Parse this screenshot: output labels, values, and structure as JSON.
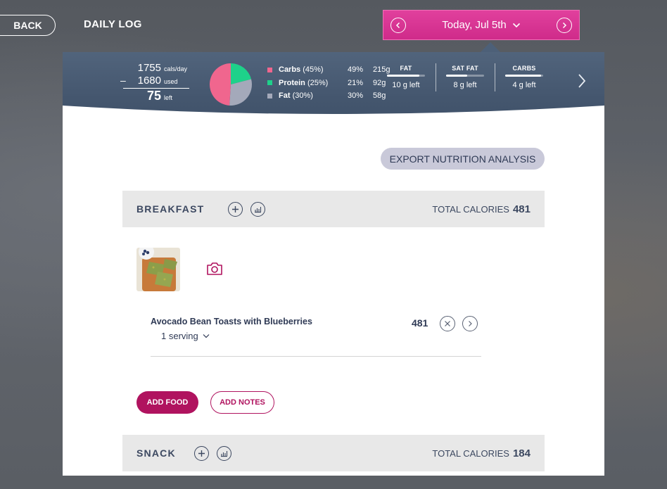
{
  "nav": {
    "back_label": "BACK",
    "title": "DAILY LOG"
  },
  "date_picker": {
    "label": "Today, Jul 5th"
  },
  "summary": {
    "calories": {
      "per_day": "1755",
      "per_day_unit": "cals/day",
      "used": "1680",
      "used_unit": "used",
      "left": "75",
      "left_unit": "left",
      "minus": "–"
    },
    "macros": [
      {
        "name": "Carbs",
        "goal": "(45%)",
        "actual_pct": "49%",
        "grams": "215g",
        "color": "#f0668e",
        "share": 0.49
      },
      {
        "name": "Protein",
        "goal": "(25%)",
        "actual_pct": "21%",
        "grams": "92g",
        "color": "#1ed18a",
        "share": 0.21
      },
      {
        "name": "Fat",
        "goal": "(30%)",
        "actual_pct": "30%",
        "grams": "58g",
        "color": "#a4a9ba",
        "share": 0.3
      }
    ],
    "nutrients": [
      {
        "label": "FAT",
        "left": "10 g left",
        "fill": 0.85
      },
      {
        "label": "SAT FAT",
        "left": "8 g left",
        "fill": 0.55
      },
      {
        "label": "CARBS",
        "left": "4 g left",
        "fill": 0.95
      }
    ]
  },
  "export_label": "EXPORT NUTRITION ANALYSIS",
  "meals": [
    {
      "title": "BREAKFAST",
      "total_label": "TOTAL CALORIES",
      "total": "481",
      "foods": [
        {
          "name": "Avocado Bean Toasts with Blueberries",
          "serving": "1 serving",
          "calories": "481"
        }
      ],
      "add_food_label": "ADD FOOD",
      "add_notes_label": "ADD NOTES"
    },
    {
      "title": "SNACK",
      "total_label": "TOTAL CALORIES",
      "total": "184"
    }
  ],
  "colors": {
    "accent": "#b0135f",
    "date_picker": "#d9348f",
    "header": "#4a5d75"
  }
}
